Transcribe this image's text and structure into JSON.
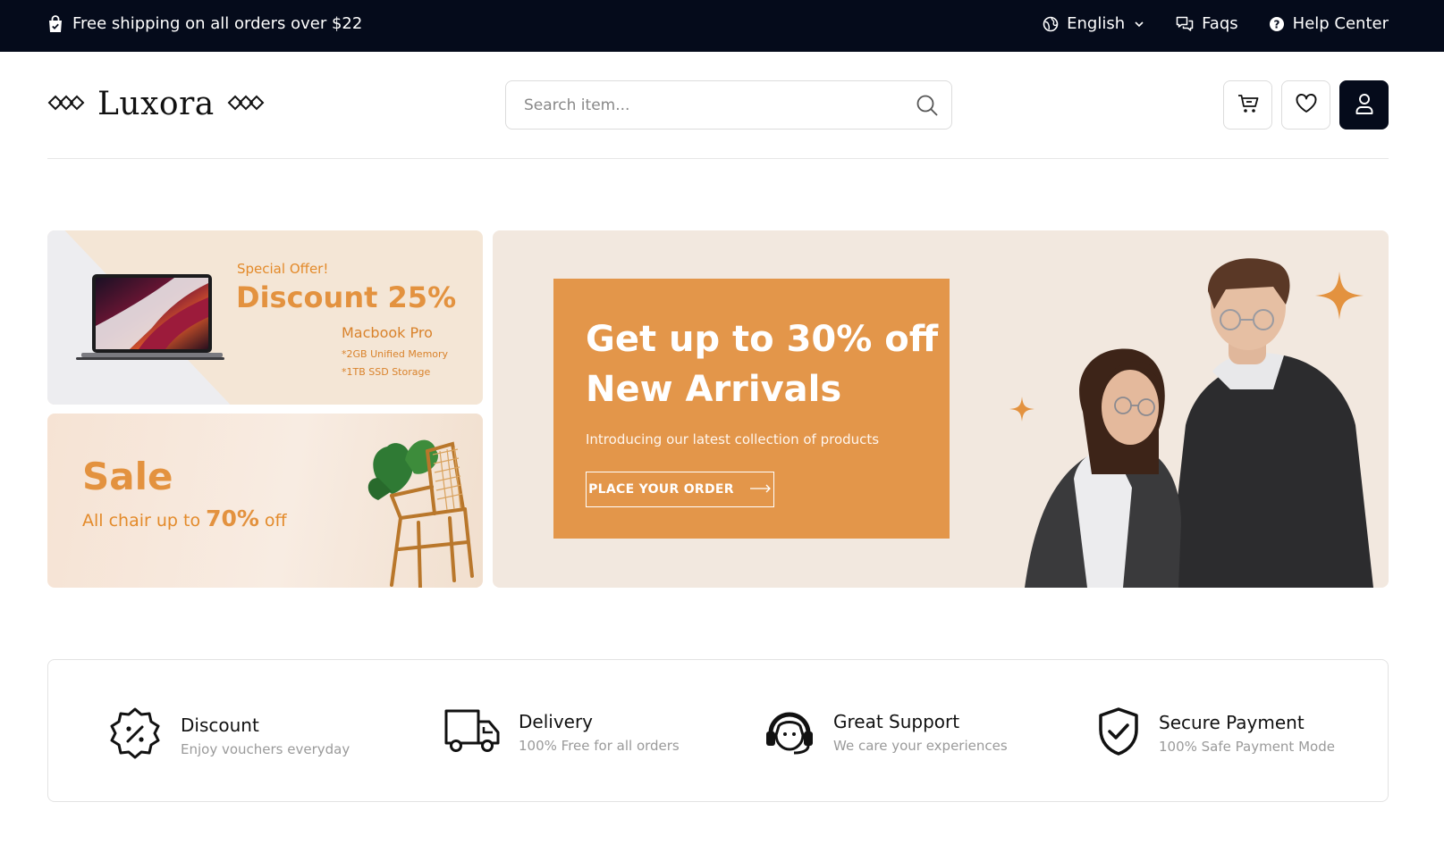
{
  "topbar": {
    "shipping_text": "Free shipping on all orders over $22",
    "language": "English",
    "faqs": "Faqs",
    "help_center": "Help Center"
  },
  "header": {
    "logo_text": "Luxora",
    "search_placeholder": "Search item...",
    "icons": [
      "cart-icon",
      "heart-icon",
      "user-icon"
    ]
  },
  "banners": {
    "laptop": {
      "eyebrow": "Special Offer!",
      "headline": "Discount 25%",
      "product": "Macbook Pro",
      "spec_1": "*2GB Unified Memory",
      "spec_2": "*1TB SSD Storage"
    },
    "chair": {
      "title": "Sale",
      "prefix": "All chair up to",
      "percent": "70%",
      "suffix": "off"
    },
    "main": {
      "headline_1": "Get up to 30% off",
      "headline_2": "New Arrivals",
      "subtitle": "Introducing our latest collection of products",
      "cta": "PLACE YOUR ORDER"
    }
  },
  "features": [
    {
      "title": "Discount",
      "subtitle": "Enjoy vouchers everyday",
      "icon": "discount-badge-icon"
    },
    {
      "title": "Delivery",
      "subtitle": "100% Free for all orders",
      "icon": "delivery-truck-icon"
    },
    {
      "title": "Great Support",
      "subtitle": "We care your experiences",
      "icon": "support-headset-icon"
    },
    {
      "title": "Secure Payment",
      "subtitle": "100% Safe Payment Mode",
      "icon": "shield-check-icon"
    }
  ],
  "colors": {
    "topbar_bg": "#050b1b",
    "accent_orange": "#e3964a",
    "banner_beige": "#f2e8df"
  }
}
